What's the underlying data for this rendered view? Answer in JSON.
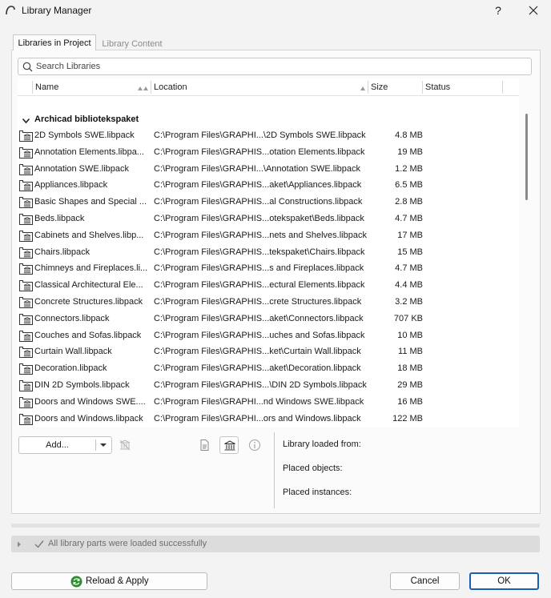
{
  "window": {
    "title": "Library Manager",
    "help_label": "?"
  },
  "tabs": [
    {
      "label": "Libraries in Project",
      "active": true
    },
    {
      "label": "Library Content",
      "active": false
    }
  ],
  "search": {
    "placeholder": "Search Libraries",
    "value": ""
  },
  "columns": {
    "name": "Name",
    "location": "Location",
    "size": "Size",
    "status": "Status"
  },
  "group": {
    "label": "Archicad bibliotekspaket",
    "expanded": true
  },
  "libraries": [
    {
      "name": "2D Symbols SWE.libpack",
      "location": "C:\\Program Files\\GRAPHI...\\2D Symbols SWE.libpack",
      "size": "4.8 MB",
      "status": ""
    },
    {
      "name": "Annotation Elements.libpa...",
      "location": "C:\\Program Files\\GRAPHIS...otation Elements.libpack",
      "size": "19 MB",
      "status": ""
    },
    {
      "name": "Annotation SWE.libpack",
      "location": "C:\\Program Files\\GRAPHI...\\Annotation SWE.libpack",
      "size": "1.2 MB",
      "status": ""
    },
    {
      "name": "Appliances.libpack",
      "location": "C:\\Program Files\\GRAPHIS...aket\\Appliances.libpack",
      "size": "6.5 MB",
      "status": ""
    },
    {
      "name": "Basic Shapes and Special ...",
      "location": "C:\\Program Files\\GRAPHIS...al Constructions.libpack",
      "size": "2.8 MB",
      "status": ""
    },
    {
      "name": "Beds.libpack",
      "location": "C:\\Program Files\\GRAPHIS...otekspaket\\Beds.libpack",
      "size": "4.7 MB",
      "status": ""
    },
    {
      "name": "Cabinets and Shelves.libp...",
      "location": "C:\\Program Files\\GRAPHIS...nets and Shelves.libpack",
      "size": "17 MB",
      "status": ""
    },
    {
      "name": "Chairs.libpack",
      "location": "C:\\Program Files\\GRAPHIS...tekspaket\\Chairs.libpack",
      "size": "15 MB",
      "status": ""
    },
    {
      "name": "Chimneys and Fireplaces.li...",
      "location": "C:\\Program Files\\GRAPHIS...s and Fireplaces.libpack",
      "size": "4.7 MB",
      "status": ""
    },
    {
      "name": "Classical Architectural Ele...",
      "location": "C:\\Program Files\\GRAPHIS...ectural Elements.libpack",
      "size": "4.4 MB",
      "status": ""
    },
    {
      "name": "Concrete Structures.libpack",
      "location": "C:\\Program Files\\GRAPHIS...crete Structures.libpack",
      "size": "3.2 MB",
      "status": ""
    },
    {
      "name": "Connectors.libpack",
      "location": "C:\\Program Files\\GRAPHIS...aket\\Connectors.libpack",
      "size": "707 KB",
      "status": ""
    },
    {
      "name": "Couches and Sofas.libpack",
      "location": "C:\\Program Files\\GRAPHIS...uches and Sofas.libpack",
      "size": "10 MB",
      "status": ""
    },
    {
      "name": "Curtain Wall.libpack",
      "location": "C:\\Program Files\\GRAPHIS...ket\\Curtain Wall.libpack",
      "size": "11 MB",
      "status": ""
    },
    {
      "name": "Decoration.libpack",
      "location": "C:\\Program Files\\GRAPHIS...aket\\Decoration.libpack",
      "size": "18 MB",
      "status": ""
    },
    {
      "name": "DIN 2D Symbols.libpack",
      "location": "C:\\Program Files\\GRAPHIS...\\DIN 2D Symbols.libpack",
      "size": "29 MB",
      "status": ""
    },
    {
      "name": "Doors and Windows SWE....",
      "location": "C:\\Program Files\\GRAPHI...nd Windows SWE.libpack",
      "size": "16 MB",
      "status": ""
    },
    {
      "name": "Doors and Windows.libpack",
      "location": "C:\\Program Files\\GRAPHI...ors and Windows.libpack",
      "size": "122 MB",
      "status": ""
    }
  ],
  "toolbar": {
    "add_label": "Add..."
  },
  "info": {
    "loaded_from_label": "Library loaded from:",
    "placed_objects_label": "Placed objects:",
    "placed_instances_label": "Placed instances:"
  },
  "status": {
    "message": "All library parts were loaded successfully"
  },
  "footer": {
    "reload_label": "Reload & Apply",
    "cancel_label": "Cancel",
    "ok_label": "OK"
  },
  "colors": {
    "accent": "#1a5fb4",
    "reload_icon": "#2e8b2e"
  }
}
